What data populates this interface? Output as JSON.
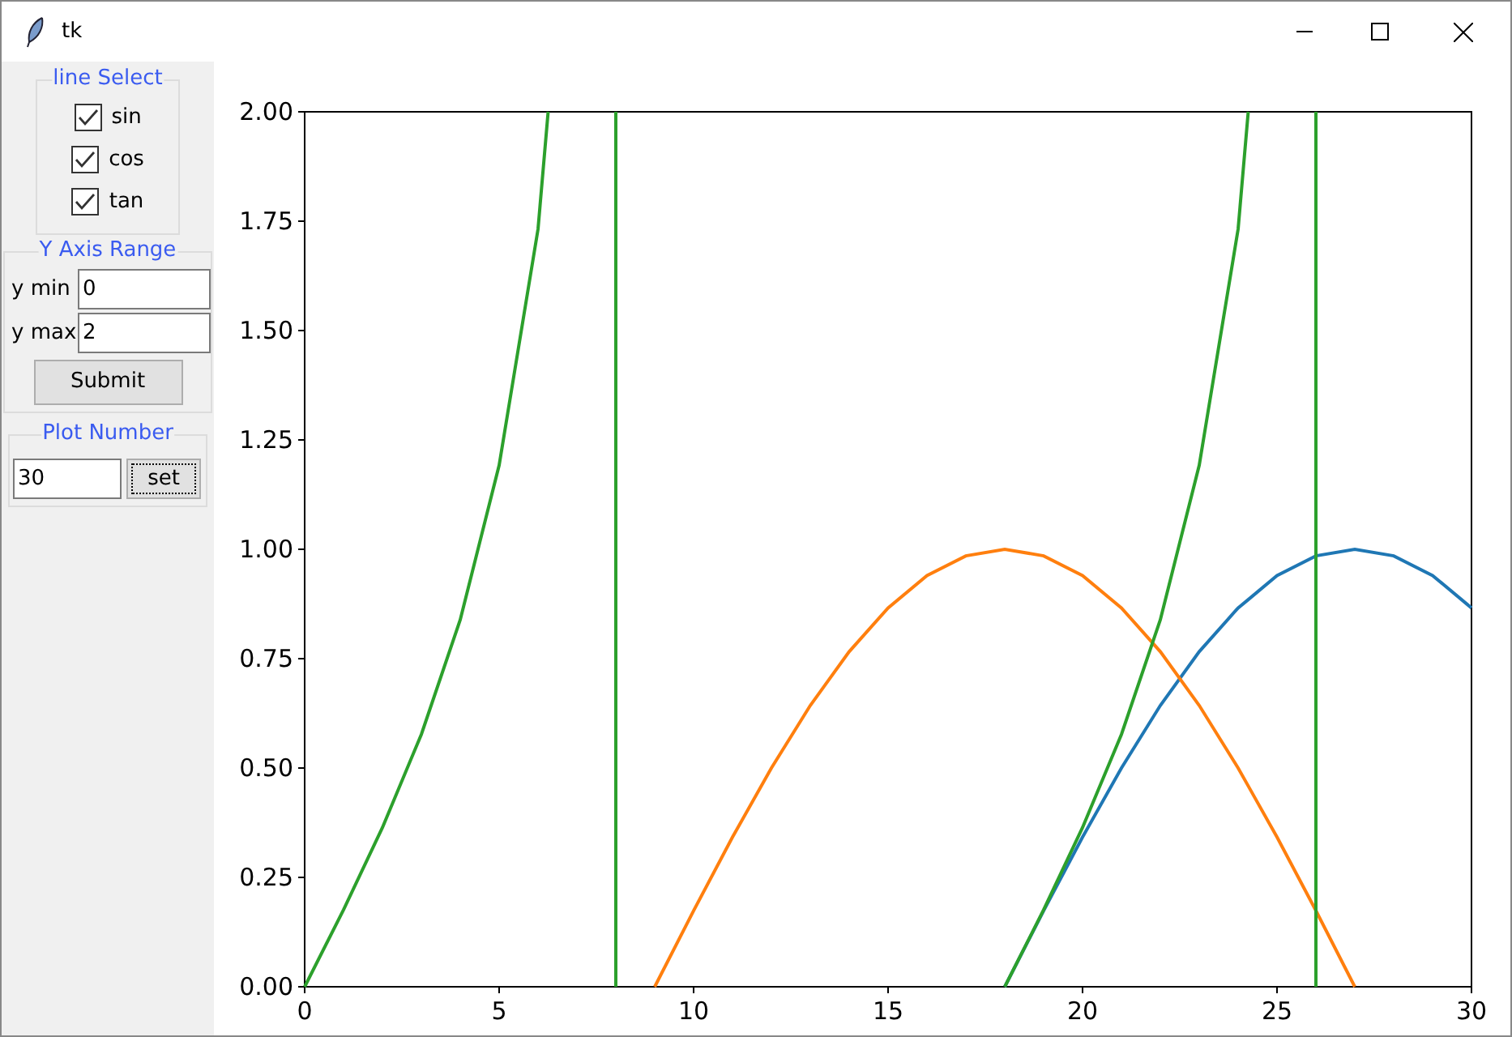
{
  "window": {
    "title": "tk"
  },
  "line_select": {
    "title": "line Select",
    "items": [
      {
        "label": "sin",
        "checked": true
      },
      {
        "label": "cos",
        "checked": true
      },
      {
        "label": "tan",
        "checked": true
      }
    ]
  },
  "y_axis_range": {
    "title": "Y Axis Range",
    "fields": [
      {
        "label": "y min",
        "value": "0"
      },
      {
        "label": "y max",
        "value": "2"
      }
    ],
    "submit": "Submit"
  },
  "plot_number": {
    "title": "Plot Number",
    "value": "30",
    "button": "set"
  },
  "plot": {
    "chart_data": {
      "type": "line",
      "x": [
        0,
        1,
        2,
        3,
        4,
        5,
        6,
        6.26,
        8,
        8,
        9,
        10,
        11,
        12,
        13,
        14,
        15,
        16,
        17,
        18,
        19,
        20,
        21,
        22,
        23,
        24,
        24.26,
        25,
        26,
        26,
        27,
        28,
        29,
        30
      ],
      "series": [
        {
          "color": "#1f77b4",
          "values": [
            null,
            null,
            null,
            null,
            null,
            null,
            null,
            null,
            null,
            null,
            null,
            null,
            null,
            null,
            null,
            null,
            null,
            null,
            null,
            0,
            0.174,
            0.342,
            0.5,
            0.643,
            0.766,
            0.866,
            0.885,
            0.94,
            0.985,
            0.985,
            1,
            0.985,
            0.94,
            0.866
          ]
        },
        {
          "color": "#ff7f0e",
          "values": [
            null,
            null,
            null,
            null,
            null,
            null,
            null,
            null,
            null,
            null,
            0,
            0.174,
            0.342,
            0.5,
            0.643,
            0.766,
            0.866,
            0.94,
            0.985,
            1,
            0.985,
            0.94,
            0.866,
            0.766,
            0.643,
            0.5,
            0.459,
            0.342,
            0.174,
            0.174,
            0,
            null,
            null,
            null
          ]
        },
        {
          "color": "#2ca02c",
          "values": [
            0,
            0.176,
            0.364,
            0.577,
            0.839,
            1.192,
            1.732,
            2,
            2,
            0,
            null,
            null,
            null,
            null,
            null,
            null,
            null,
            null,
            null,
            0,
            0.176,
            0.364,
            0.577,
            0.839,
            1.192,
            1.732,
            2,
            null,
            2,
            0,
            null,
            null,
            null,
            null
          ]
        }
      ],
      "xlim": [
        0,
        30
      ],
      "ylim": [
        0,
        2
      ],
      "xticks": [
        0,
        5,
        10,
        15,
        20,
        25,
        30
      ],
      "yticks": [
        {
          "value": 0,
          "label": "0.00"
        },
        {
          "value": 0.25,
          "label": "0.25"
        },
        {
          "value": 0.5,
          "label": "0.50"
        },
        {
          "value": 0.75,
          "label": "0.75"
        },
        {
          "value": 1,
          "label": "1.00"
        },
        {
          "value": 1.25,
          "label": "1.25"
        },
        {
          "value": 1.5,
          "label": "1.50"
        },
        {
          "value": 1.75,
          "label": "1.75"
        },
        {
          "value": 2,
          "label": "2.00"
        }
      ]
    }
  }
}
